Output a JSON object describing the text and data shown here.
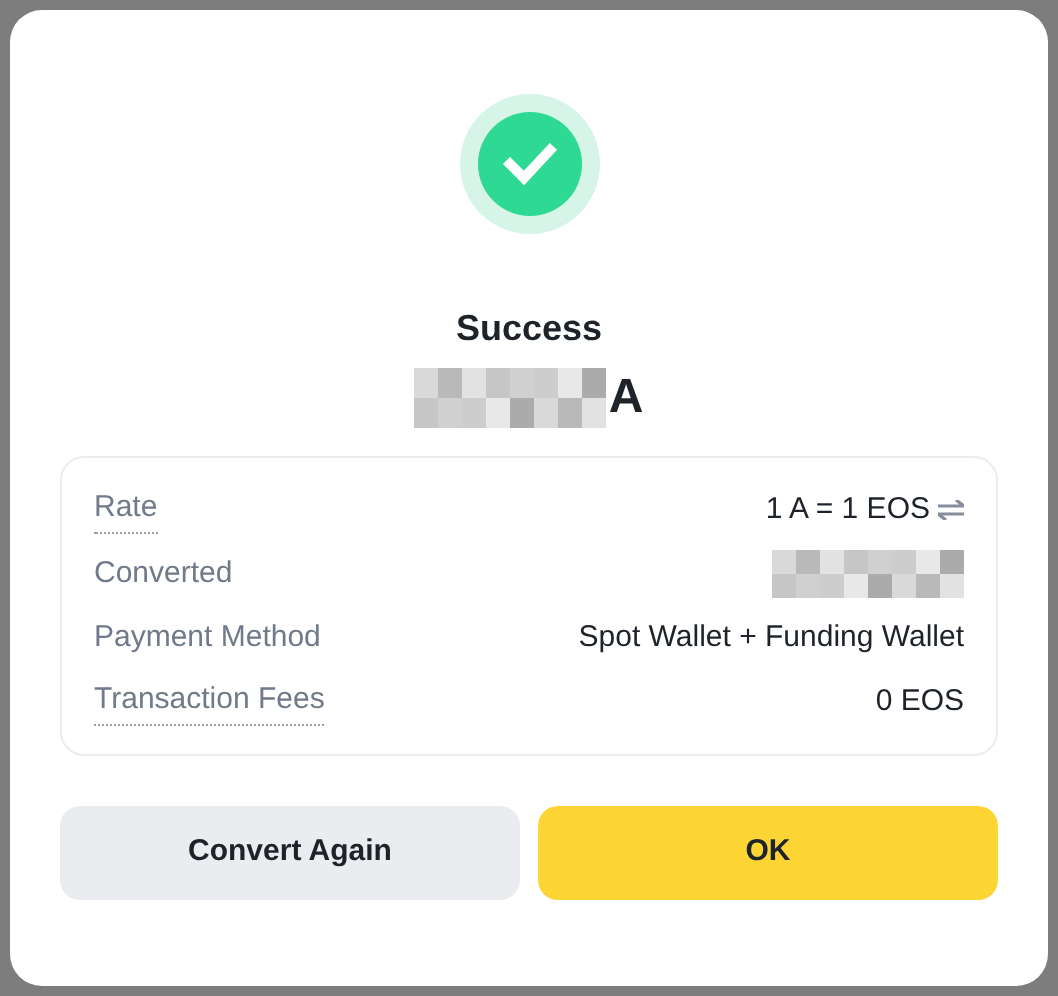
{
  "dialog": {
    "title": "Success",
    "amount": {
      "redacted": true,
      "suffix": "A"
    },
    "details": [
      {
        "label": "Rate",
        "value": "1 A = 1 EOS",
        "kind": "rate",
        "underlined": true
      },
      {
        "label": "Converted",
        "kind": "redacted",
        "underlined": false
      },
      {
        "label": "Payment Method",
        "value": "Spot Wallet + Funding Wallet",
        "kind": "text",
        "underlined": false
      },
      {
        "label": "Transaction Fees",
        "value": "0 EOS",
        "kind": "text",
        "underlined": true
      }
    ],
    "buttons": [
      {
        "label": "Convert Again",
        "kind": "secondary"
      },
      {
        "label": "OK",
        "kind": "primary"
      }
    ]
  }
}
